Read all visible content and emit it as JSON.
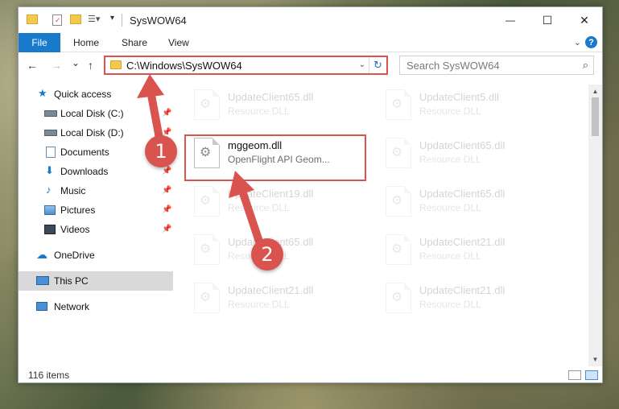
{
  "window": {
    "title": "SysWOW64",
    "minimize": "—",
    "maximize": "☐",
    "close": "✕"
  },
  "ribbon": {
    "tabs": [
      "File",
      "Home",
      "Share",
      "View"
    ],
    "collapse": "⌄",
    "help": "?"
  },
  "nav": {
    "back": "←",
    "forward": "→",
    "recent": "⌄",
    "up": "↑",
    "address": "C:\\Windows\\SysWOW64",
    "address_dropdown": "⌄",
    "refresh": "↻",
    "search_placeholder": "Search SysWOW64",
    "search_icon": "⌕"
  },
  "sidebar": {
    "items": [
      {
        "label": "Quick access",
        "icon": "star-icon",
        "pinned": false
      },
      {
        "label": "Local Disk (C:)",
        "icon": "drive-icon",
        "pinned": true
      },
      {
        "label": "Local Disk (D:)",
        "icon": "drive-icon",
        "pinned": true
      },
      {
        "label": "Documents",
        "icon": "documents-icon",
        "pinned": true
      },
      {
        "label": "Downloads",
        "icon": "download-icon",
        "pinned": true
      },
      {
        "label": "Music",
        "icon": "music-icon",
        "pinned": true
      },
      {
        "label": "Pictures",
        "icon": "pictures-icon",
        "pinned": true
      },
      {
        "label": "Videos",
        "icon": "videos-icon",
        "pinned": true
      },
      {
        "label": "OneDrive",
        "icon": "cloud-icon",
        "pinned": false
      },
      {
        "label": "This PC",
        "icon": "computer-icon",
        "pinned": false,
        "selected": true
      },
      {
        "label": "Network",
        "icon": "network-icon",
        "pinned": false
      }
    ],
    "pin_glyph": "📌"
  },
  "files": {
    "highlighted": {
      "name": "mggeom.dll",
      "description": "OpenFlight API Geom..."
    },
    "faded": [
      {
        "name": "UpdateClient65.dll",
        "description": "Resource DLL"
      },
      {
        "name": "UpdateClient5.dll",
        "description": "Resource DLL"
      },
      {
        "name": "UpdateClient65.dll",
        "description": "Resource DLL"
      },
      {
        "name": "UpdateClient19.dll",
        "description": "Resource DLL"
      },
      {
        "name": "UpdateClient65.dll",
        "description": "Resource DLL"
      },
      {
        "name": "UpdateClient65.dll",
        "description": "Resource DLL"
      },
      {
        "name": "UpdateClient21.dll",
        "description": "Resource DLL"
      },
      {
        "name": "UpdateClient21.dll",
        "description": "Resource DLL"
      },
      {
        "name": "UpdateClient21.dll",
        "description": "Resource DLL"
      }
    ]
  },
  "status": {
    "item_count": "116 items"
  },
  "callouts": [
    "1",
    "2"
  ],
  "colors": {
    "accent": "#1979ca",
    "annotation": "#d9534f"
  }
}
